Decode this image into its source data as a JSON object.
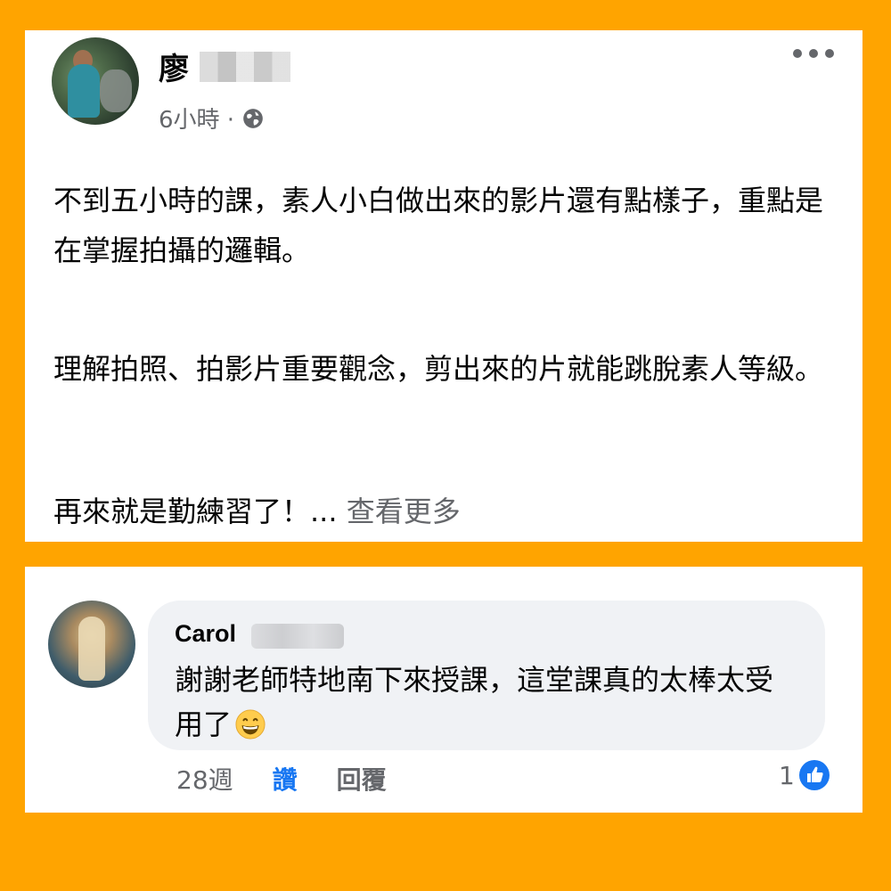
{
  "post": {
    "author_name": "廖",
    "time": "6小時 ·",
    "paragraphs": [
      "不到五小時的課，素人小白做出來的影片還有點樣子，重點是在掌握拍攝的邏輯。",
      "理解拍照、拍影片重要觀念，剪出來的片就能跳脫素人等級。",
      "再來就是勤練習了！..."
    ],
    "see_more": "查看更多"
  },
  "comment": {
    "author_first_name": "Carol",
    "text": "謝謝老師特地南下來授課，這堂課真的太棒太受用了",
    "emoji": "grinning-face",
    "time": "28週",
    "like_label": "讚",
    "reply_label": "回覆",
    "reaction_count": "1"
  },
  "colors": {
    "background": "#FFA400",
    "link_blue": "#1877f2",
    "secondary_text": "#65676b",
    "bubble": "#f0f2f5"
  }
}
